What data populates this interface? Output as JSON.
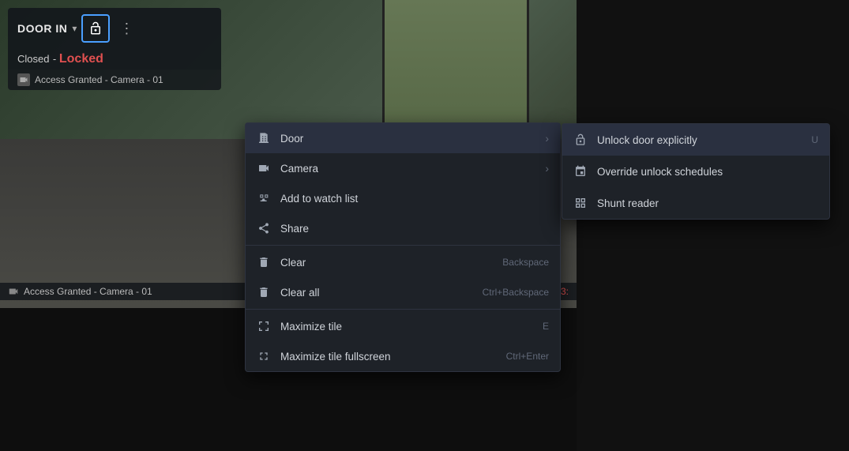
{
  "camera": {
    "title": "DOOR IN",
    "status": "Closed",
    "status_separator": " - ",
    "locked_text": "Locked",
    "access_text": "Access Granted - Camera - 01",
    "status_strip_text": "Access Granted - Camera - 01",
    "time_text": "2:23:"
  },
  "contextMenu": {
    "items": [
      {
        "id": "door",
        "label": "Door",
        "icon": "door-icon",
        "hasArrow": true,
        "shortcut": ""
      },
      {
        "id": "camera",
        "label": "Camera",
        "icon": "camera-icon",
        "hasArrow": true,
        "shortcut": ""
      },
      {
        "id": "watch",
        "label": "Add to watch list",
        "icon": "binoculars-icon",
        "hasArrow": false,
        "shortcut": ""
      },
      {
        "id": "share",
        "label": "Share",
        "icon": "share-icon",
        "hasArrow": false,
        "shortcut": ""
      },
      {
        "id": "divider1",
        "isDivider": true
      },
      {
        "id": "clear",
        "label": "Clear",
        "icon": "trash-icon",
        "hasArrow": false,
        "shortcut": "Backspace"
      },
      {
        "id": "clearall",
        "label": "Clear all",
        "icon": "trash-icon",
        "hasArrow": false,
        "shortcut": "Ctrl+Backspace"
      },
      {
        "id": "divider2",
        "isDivider": true
      },
      {
        "id": "maximize",
        "label": "Maximize tile",
        "icon": "maximize-icon",
        "hasArrow": false,
        "shortcut": "E"
      },
      {
        "id": "maximizefs",
        "label": "Maximize tile fullscreen",
        "icon": "fullscreen-icon",
        "hasArrow": false,
        "shortcut": "Ctrl+Enter"
      }
    ]
  },
  "submenu": {
    "items": [
      {
        "id": "unlock",
        "label": "Unlock door explicitly",
        "icon": "unlock-icon",
        "shortcut": "U",
        "highlighted": true
      },
      {
        "id": "override",
        "label": "Override unlock schedules",
        "icon": "calendar-icon",
        "shortcut": ""
      },
      {
        "id": "shunt",
        "label": "Shunt reader",
        "icon": "grid-icon",
        "shortcut": ""
      }
    ]
  },
  "icons": {
    "door": "🚪",
    "camera": "📷",
    "binoculars": "🔭",
    "share": "↗",
    "trash": "🗑",
    "maximize": "⬜",
    "fullscreen": "⛶",
    "unlock": "🔓",
    "calendar": "📅",
    "grid": "⊞"
  }
}
